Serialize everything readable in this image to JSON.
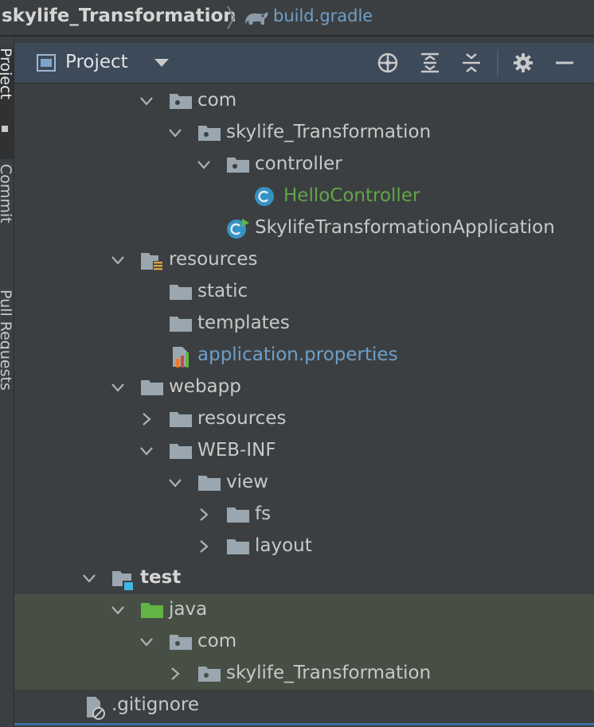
{
  "breadcrumb": {
    "project": "skylife_Transformation",
    "file": "build.gradle"
  },
  "side_tabs": [
    "Project",
    "Commit",
    "Pull Requests"
  ],
  "panel": {
    "title": "Project",
    "toolbar": [
      "locate-icon",
      "expand-all-icon",
      "collapse-all-icon",
      "gear-icon",
      "minimize-icon"
    ]
  },
  "tree": [
    {
      "label": "com",
      "expanded": true,
      "type": "package"
    },
    {
      "label": "skylife_Transformation",
      "expanded": true,
      "type": "package"
    },
    {
      "label": "controller",
      "expanded": true,
      "type": "package"
    },
    {
      "label": "HelloController",
      "type": "class",
      "color": "#62a44a"
    },
    {
      "label": "SkylifeTransformationApplication",
      "type": "spring-app-class"
    },
    {
      "label": "resources",
      "expanded": true,
      "type": "resources-root"
    },
    {
      "label": "static",
      "type": "folder"
    },
    {
      "label": "templates",
      "type": "folder"
    },
    {
      "label": "application.properties",
      "type": "properties-file",
      "color": "#6e9fc9"
    },
    {
      "label": "webapp",
      "expanded": true,
      "type": "folder"
    },
    {
      "label": "resources",
      "expanded": false,
      "type": "folder"
    },
    {
      "label": "WEB-INF",
      "expanded": true,
      "type": "folder"
    },
    {
      "label": "view",
      "expanded": true,
      "type": "folder"
    },
    {
      "label": "fs",
      "expanded": false,
      "type": "folder"
    },
    {
      "label": "layout",
      "expanded": false,
      "type": "folder"
    },
    {
      "label": "test",
      "expanded": true,
      "type": "test-module"
    },
    {
      "label": "java",
      "expanded": true,
      "type": "test-source-root"
    },
    {
      "label": "com",
      "expanded": true,
      "type": "package"
    },
    {
      "label": "skylife_Transformation",
      "expanded": false,
      "type": "package"
    },
    {
      "label": ".gitignore",
      "type": "ignored-file"
    }
  ],
  "colors": {
    "background": "#3c3f41",
    "header": "#3c4a5a",
    "highlight_rows": "#474f45",
    "green_text": "#62a44a",
    "blue_text": "#6e9fc9"
  }
}
